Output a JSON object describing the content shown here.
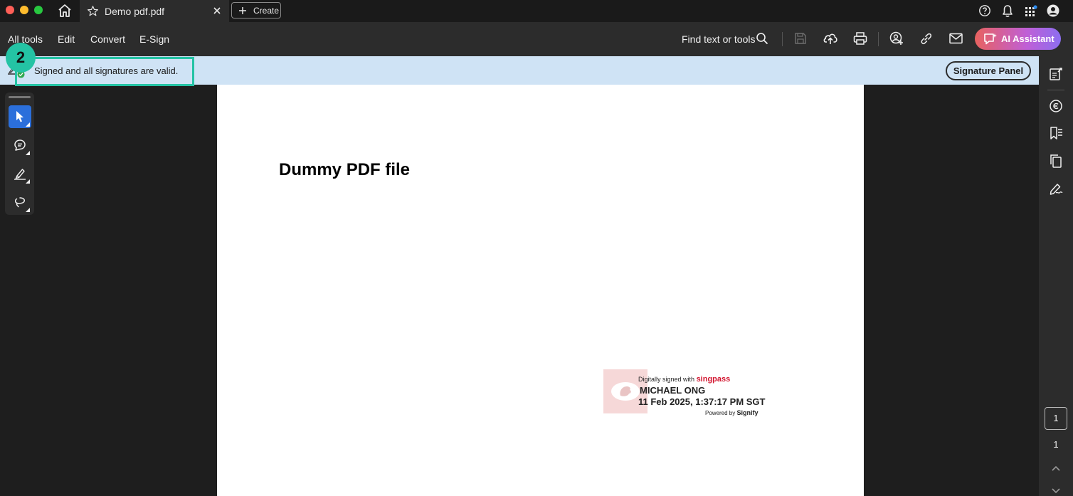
{
  "titlebar": {
    "tab_title": "Demo pdf.pdf",
    "create_label": "Create",
    "traffic_colors": [
      "#ff5f57",
      "#febc2e",
      "#28c840"
    ]
  },
  "toolbar": {
    "menu": [
      "All tools",
      "Edit",
      "Convert",
      "E-Sign"
    ],
    "find_text": "Find text or tools",
    "ai_label": "AI Assistant",
    "icons": [
      "search-icon",
      "save-icon",
      "upload-icon",
      "print-icon",
      "share-user-icon",
      "link-icon",
      "mail-icon"
    ]
  },
  "signature_bar": {
    "message": "Signed and all signatures are valid.",
    "panel_button": "Signature Panel",
    "step_number": "2",
    "highlight_color": "#24c3a4"
  },
  "left_rail": {
    "tools": [
      "select-arrow-icon",
      "comment-icon",
      "highlight-pen-icon",
      "lasso-draw-icon"
    ],
    "active_color": "#2b6fdb"
  },
  "right_rail": {
    "icons": [
      "edit-pdf-icon",
      "comment-list-icon",
      "bookmark-list-icon",
      "pages-icon",
      "fill-sign-icon"
    ],
    "current_page": "1",
    "total_pages": "1"
  },
  "document": {
    "heading": "Dummy PDF file",
    "stamp": {
      "line1_prefix": "Digitally signed with",
      "brand": "singpass",
      "name": "MICHAEL ONG",
      "date": "11 Feb 2025, 1:37:17 PM SGT",
      "powered_prefix": "Powered by",
      "powered_brand": "Signify"
    }
  }
}
